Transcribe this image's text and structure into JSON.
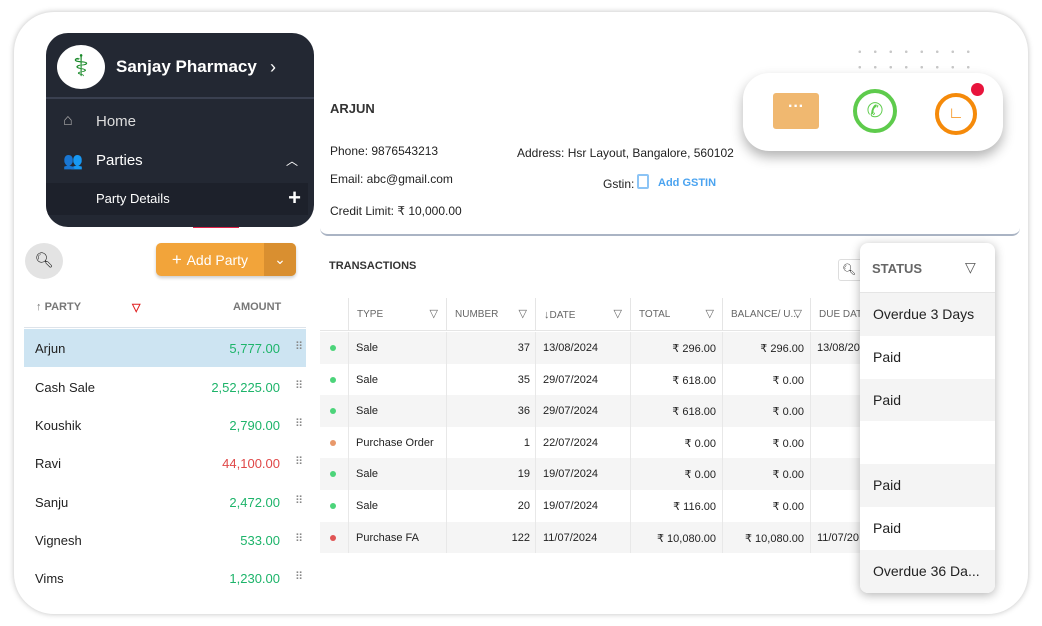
{
  "sidebar": {
    "business_name": "Sanjay Pharmacy",
    "items": [
      {
        "label": "Home",
        "icon": "home-icon"
      },
      {
        "label": "Parties",
        "icon": "users-icon"
      }
    ],
    "sub_item": "Party Details"
  },
  "parties": {
    "add_label": "Add Party",
    "col_party": "PARTY",
    "col_amount": "AMOUNT",
    "rows": [
      {
        "name": "Arjun",
        "amount": "5,777.00",
        "color": "#1db46a"
      },
      {
        "name": "Cash Sale",
        "amount": "2,52,225.00",
        "color": "#1db46a"
      },
      {
        "name": "Koushik",
        "amount": "2,790.00",
        "color": "#1db46a"
      },
      {
        "name": "Ravi",
        "amount": "44,100.00",
        "color": "#e04848"
      },
      {
        "name": "Sanju",
        "amount": "2,472.00",
        "color": "#1db46a"
      },
      {
        "name": "Vignesh",
        "amount": "533.00",
        "color": "#1db46a"
      },
      {
        "name": "Vims",
        "amount": "1,230.00",
        "color": "#1db46a"
      }
    ]
  },
  "party": {
    "name": "ARJUN",
    "phone": "Phone: 9876543213",
    "address": "Address: Hsr Layout, Bangalore, 560102",
    "email": "Email: abc@gmail.com",
    "gstin_label": "Gstin:",
    "add_gstin": "Add GSTIN",
    "credit_limit": "Credit Limit: ₹ 10,000.00"
  },
  "transactions": {
    "title": "TRANSACTIONS",
    "columns": [
      "TYPE",
      "NUMBER",
      "DATE",
      "TOTAL",
      "BALANCE/ U...",
      "DUE DATE"
    ],
    "rows": [
      {
        "type": "Sale",
        "number": "37",
        "date": "13/08/2024",
        "total": "₹ 296.00",
        "balance": "₹ 296.00",
        "due": "13/08/20",
        "dot": "#4cd47a"
      },
      {
        "type": "Sale",
        "number": "35",
        "date": "29/07/2024",
        "total": "₹ 618.00",
        "balance": "₹ 0.00",
        "due": "",
        "dot": "#4cd47a"
      },
      {
        "type": "Sale",
        "number": "36",
        "date": "29/07/2024",
        "total": "₹ 618.00",
        "balance": "₹ 0.00",
        "due": "",
        "dot": "#4cd47a"
      },
      {
        "type": "Purchase Order",
        "number": "1",
        "date": "22/07/2024",
        "total": "₹ 0.00",
        "balance": "₹ 0.00",
        "due": "",
        "dot": "#e8986a"
      },
      {
        "type": "Sale",
        "number": "19",
        "date": "19/07/2024",
        "total": "₹ 0.00",
        "balance": "₹ 0.00",
        "due": "",
        "dot": "#4cd47a"
      },
      {
        "type": "Sale",
        "number": "20",
        "date": "19/07/2024",
        "total": "₹ 116.00",
        "balance": "₹ 0.00",
        "due": "",
        "dot": "#4cd47a"
      },
      {
        "type": "Purchase FA",
        "number": "122",
        "date": "11/07/2024",
        "total": "₹ 10,080.00",
        "balance": "₹ 10,080.00",
        "due": "11/07/20",
        "dot": "#e05454"
      }
    ]
  },
  "status": {
    "header": "STATUS",
    "rows": [
      "Overdue 3 Days",
      "Paid",
      "Paid",
      "",
      "Paid",
      "Paid",
      "Overdue 36 Da..."
    ]
  },
  "colors": {
    "accent": "#f2a43a",
    "sidebar": "#232833",
    "selected_row": "#cde4f2",
    "positive": "#1db46a",
    "negative": "#e04848",
    "link": "#4aa3f0"
  }
}
